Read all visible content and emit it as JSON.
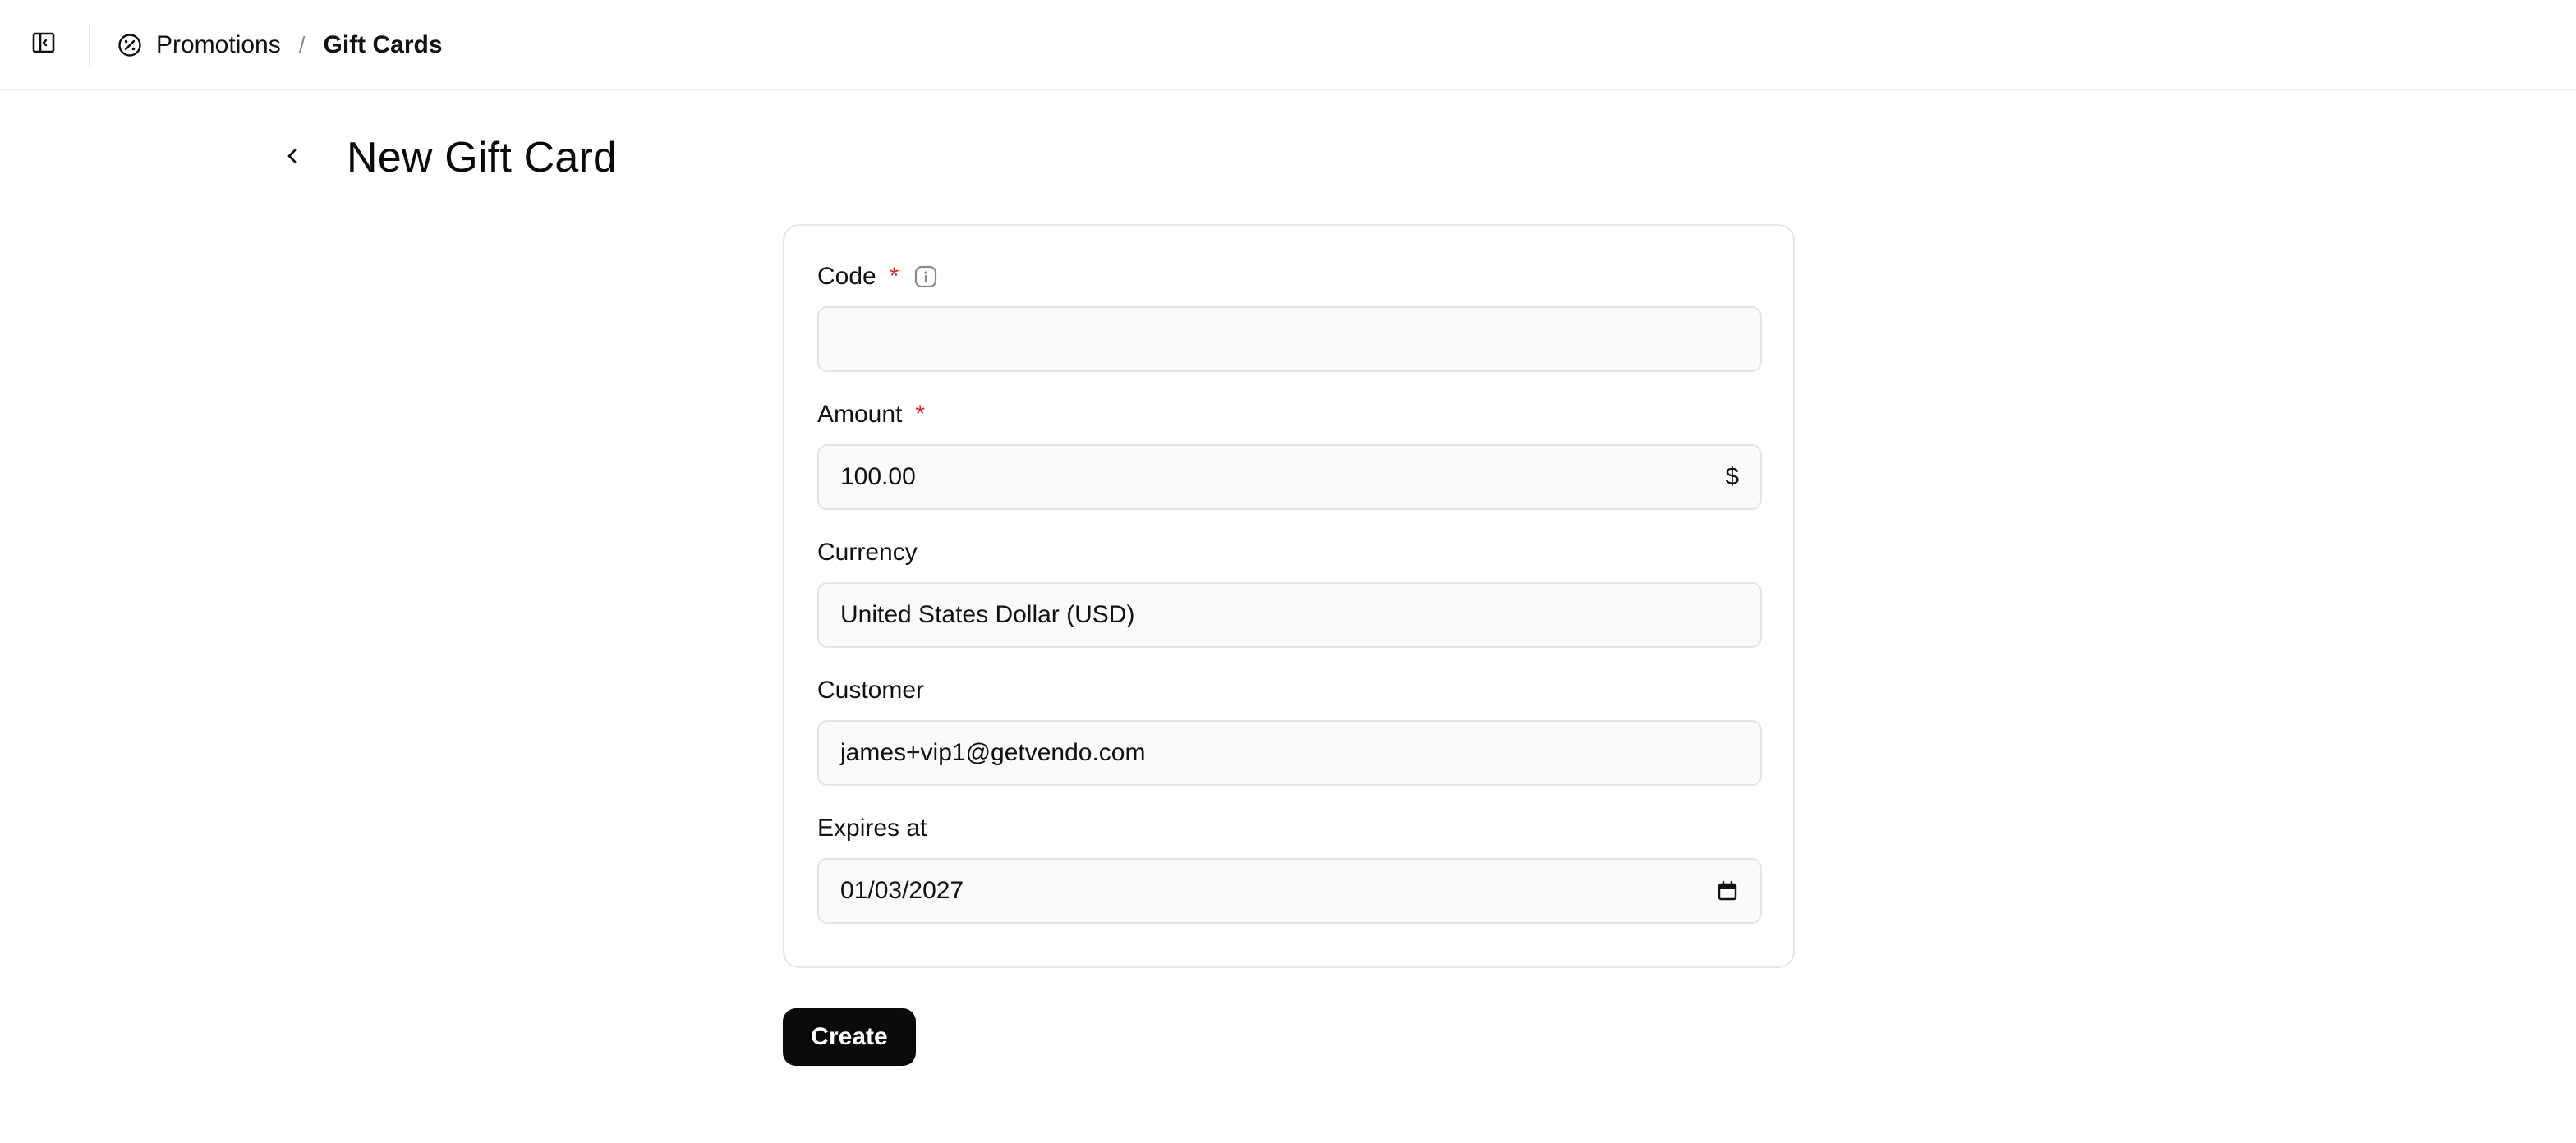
{
  "header": {
    "sidebar_toggle_icon": "sidebar-panel-icon",
    "breadcrumb": {
      "section_icon": "percent-badge-icon",
      "section": "Promotions",
      "separator": "/",
      "current": "Gift Cards"
    }
  },
  "page": {
    "back_icon": "chevron-left-icon",
    "title": "New Gift Card"
  },
  "form": {
    "code": {
      "label": "Code",
      "required_mark": "*",
      "info_icon": "info-icon",
      "value": "",
      "placeholder": ""
    },
    "amount": {
      "label": "Amount",
      "required_mark": "*",
      "value": "100.00",
      "suffix": "$"
    },
    "currency": {
      "label": "Currency",
      "value": "United States Dollar (USD)"
    },
    "customer": {
      "label": "Customer",
      "value": "james+vip1@getvendo.com"
    },
    "expires_at": {
      "label": "Expires at",
      "value": "01/03/2027",
      "calendar_icon": "calendar-icon"
    },
    "submit_label": "Create"
  },
  "colors": {
    "primary_button": "#0a0a0a",
    "required": "#e5262b",
    "border": "#e4e4e4"
  }
}
